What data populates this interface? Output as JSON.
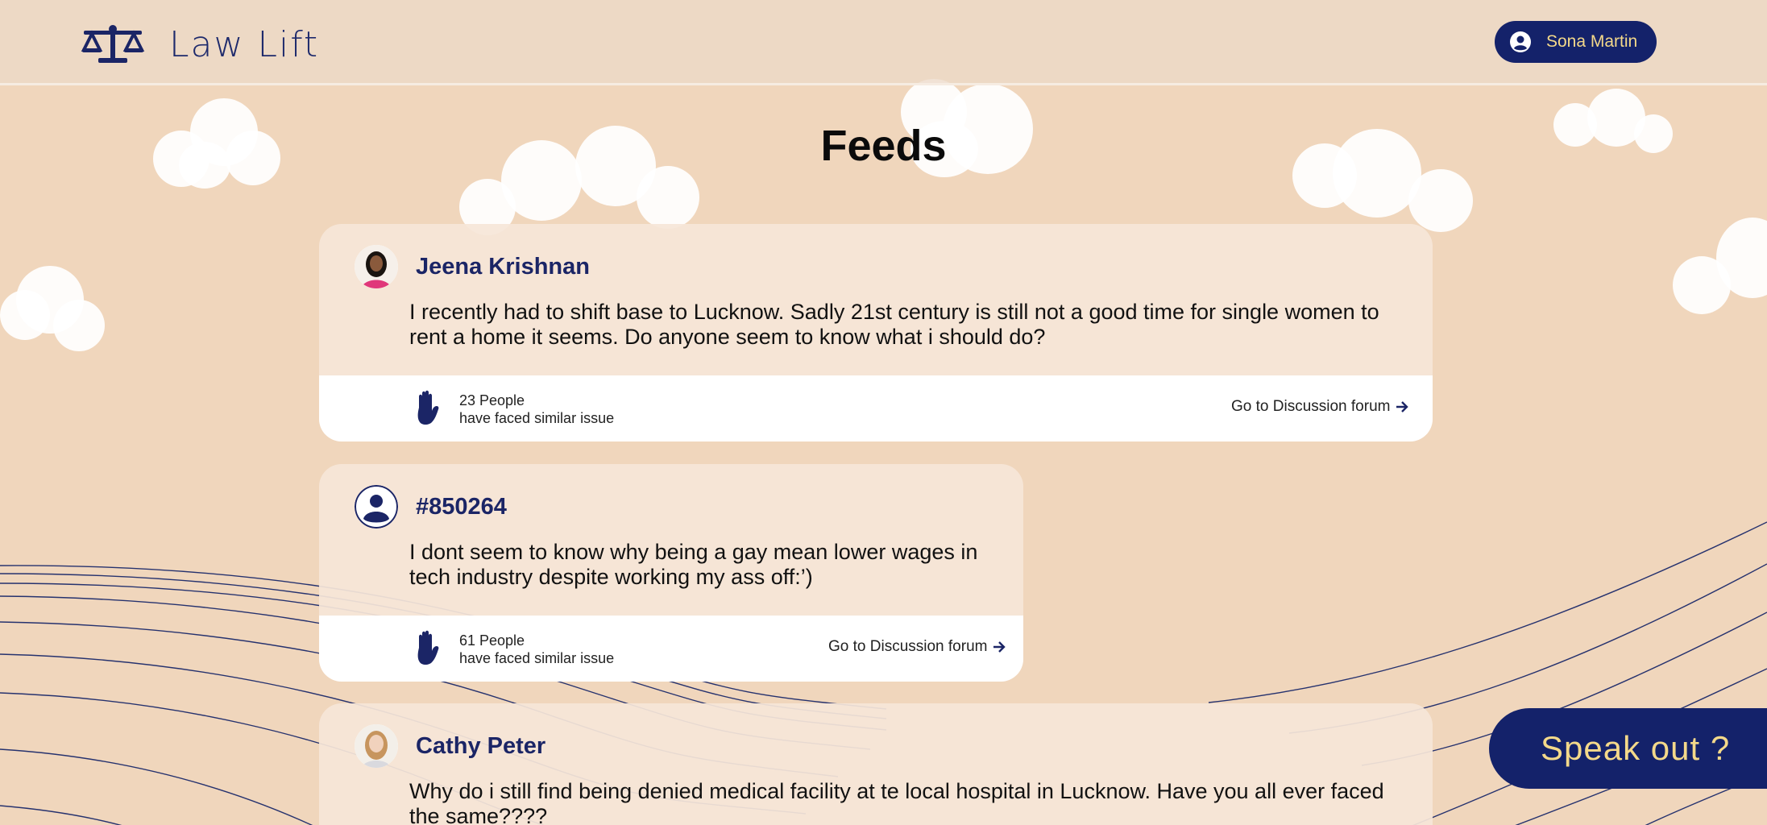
{
  "app": {
    "name": "Law Lift"
  },
  "header": {
    "user_name": "Sona Martin"
  },
  "page": {
    "title": "Feeds"
  },
  "posts": [
    {
      "author": "Jeena Krishnan",
      "text": "I recently had to shift base to Lucknow. Sadly 21st century is still not a good time for single women to rent a home it seems. Do anyone seem to know what i should do?",
      "count": "23 People",
      "count_sub": "have faced similar issue",
      "link": "Go to Discussion forum"
    },
    {
      "author": "#850264",
      "text": "I dont seem to know why being a gay mean lower wages in tech industry despite working my ass off:’)",
      "count": "61 People",
      "count_sub": "have faced similar issue",
      "link": "Go to Discussion forum"
    },
    {
      "author": "Cathy Peter",
      "text": "Why do i still find being denied medical facility at te local hospital in Lucknow. Have you all ever faced the same????"
    }
  ],
  "cta": {
    "label": "Speak out ?"
  },
  "colors": {
    "background": "#f0d6bc",
    "navy": "#14226a",
    "accent_text": "#f4d98a",
    "author": "#1b2566"
  }
}
